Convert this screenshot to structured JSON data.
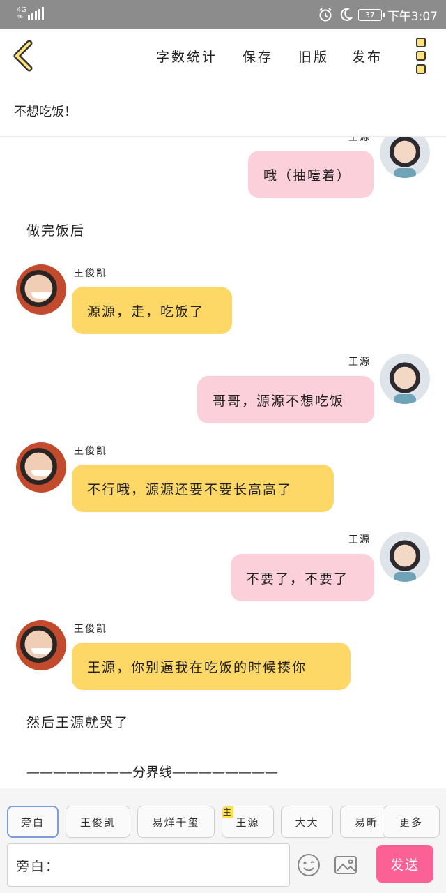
{
  "status_bar": {
    "network": "4G",
    "network_sub": "46",
    "battery": "37",
    "time": "下午3:07"
  },
  "toolbar": {
    "word_count": "字数统计",
    "save": "保存",
    "old_version": "旧版",
    "publish": "发布"
  },
  "title": "不想吃饭！",
  "chat": {
    "partial_name": "王源",
    "messages": [
      {
        "type": "right",
        "speaker": "王源",
        "text": "哦（抽噎着）"
      },
      {
        "type": "narration",
        "text": "做完饭后"
      },
      {
        "type": "left",
        "speaker": "王俊凯",
        "text": "源源，走，吃饭了"
      },
      {
        "type": "right",
        "speaker": "王源",
        "text": "哥哥，源源不想吃饭"
      },
      {
        "type": "left",
        "speaker": "王俊凯",
        "text": "不行哦，源源还要不要长高高了"
      },
      {
        "type": "right",
        "speaker": "王源",
        "text": "不要了，不要了"
      },
      {
        "type": "left",
        "speaker": "王俊凯",
        "text": "王源，你别逼我在吃饭的时候揍你"
      },
      {
        "type": "narration",
        "text": "然后王源就哭了"
      },
      {
        "type": "narration",
        "text": "————————分界线————————"
      }
    ]
  },
  "roles": {
    "narrator": "旁白",
    "kai": "王俊凯",
    "yi": "易烊千玺",
    "main_tag": "主",
    "yuan": "王源",
    "dada": "大大",
    "partial": "易昕",
    "more": "更多"
  },
  "input": {
    "value": "旁白："
  },
  "send_label": "发送",
  "colors": {
    "left_bubble": "#fdd866",
    "right_bubble": "#fbd0da",
    "send_button": "#fb6195",
    "selected_chip_border": "#7b9ed9",
    "status_bar": "#8c8c8c"
  },
  "icons": {
    "back": "chevron-left-icon",
    "menu": "kebab-menu-icon",
    "emoji": "emoji-icon",
    "image": "image-icon"
  }
}
